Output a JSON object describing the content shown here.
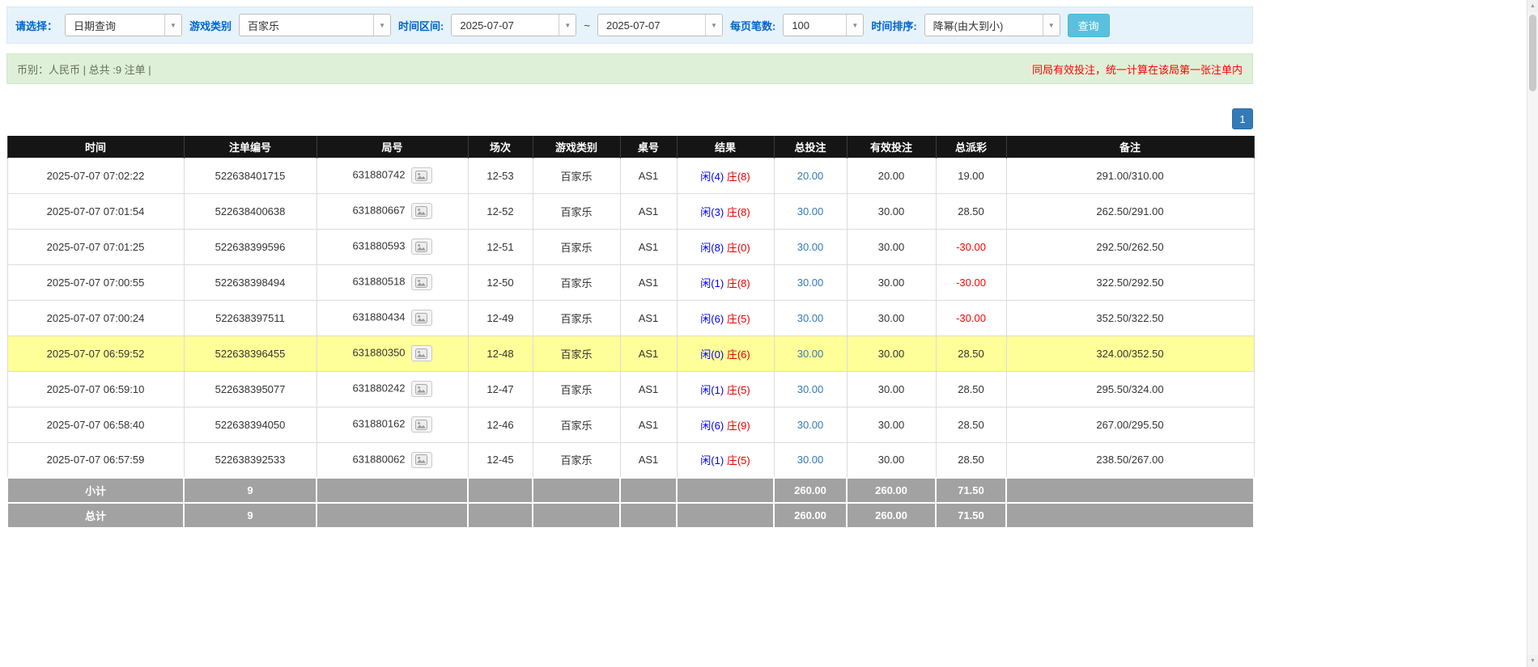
{
  "filter": {
    "select_label": "请选择：",
    "query_type": "日期查询",
    "game_label": "游戏类别",
    "game_value": "百家乐",
    "range_label": "时间区间:",
    "date_from": "2025-07-07",
    "range_sep": "~",
    "date_to": "2025-07-07",
    "page_size_label": "每页笔数:",
    "page_size_value": "100",
    "sort_label": "时间排序:",
    "sort_value": "降幂(由大到小)",
    "search_button": "查询"
  },
  "info_bar": {
    "summary": "币别：人民币 | 总共 :9 注单 |",
    "notice": "同局有效投注，统一计算在该局第一张注单内"
  },
  "pagination": {
    "current": "1"
  },
  "icons": {
    "dropdown_arrow": "▼",
    "scroll_up": "▲",
    "scroll_down": "▼",
    "round_media_icon": "video-thumbnail-icon"
  },
  "colors": {
    "accent_blue": "#337ab7",
    "search_button": "#5bc0de",
    "player_blue": "#0000ee",
    "banker_red": "#e60000",
    "negative_red": "#ff0000",
    "highlight_yellow": "#ffff99",
    "header_black": "#151515",
    "footer_gray": "#a2a2a2"
  },
  "table": {
    "headers": [
      "时间",
      "注单编号",
      "局号",
      "场次",
      "游戏类别",
      "桌号",
      "结果",
      "总投注",
      "有效投注",
      "总派彩",
      "备注"
    ],
    "rows": [
      {
        "time": "2025-07-07 07:02:22",
        "bet_no": "522638401715",
        "round_no": "631880742",
        "session": "12-53",
        "game": "百家乐",
        "table_no": "AS1",
        "result_player": "闲(4)",
        "result_banker": "庄(8)",
        "total_bet": "20.00",
        "valid_bet": "20.00",
        "payout": "19.00",
        "note": "291.00/310.00",
        "highlight": false
      },
      {
        "time": "2025-07-07 07:01:54",
        "bet_no": "522638400638",
        "round_no": "631880667",
        "session": "12-52",
        "game": "百家乐",
        "table_no": "AS1",
        "result_player": "闲(3)",
        "result_banker": "庄(8)",
        "total_bet": "30.00",
        "valid_bet": "30.00",
        "payout": "28.50",
        "note": "262.50/291.00",
        "highlight": false
      },
      {
        "time": "2025-07-07 07:01:25",
        "bet_no": "522638399596",
        "round_no": "631880593",
        "session": "12-51",
        "game": "百家乐",
        "table_no": "AS1",
        "result_player": "闲(8)",
        "result_banker": "庄(0)",
        "total_bet": "30.00",
        "valid_bet": "30.00",
        "payout": "-30.00",
        "note": "292.50/262.50",
        "highlight": false
      },
      {
        "time": "2025-07-07 07:00:55",
        "bet_no": "522638398494",
        "round_no": "631880518",
        "session": "12-50",
        "game": "百家乐",
        "table_no": "AS1",
        "result_player": "闲(1)",
        "result_banker": "庄(8)",
        "total_bet": "30.00",
        "valid_bet": "30.00",
        "payout": "-30.00",
        "note": "322.50/292.50",
        "highlight": false
      },
      {
        "time": "2025-07-07 07:00:24",
        "bet_no": "522638397511",
        "round_no": "631880434",
        "session": "12-49",
        "game": "百家乐",
        "table_no": "AS1",
        "result_player": "闲(6)",
        "result_banker": "庄(5)",
        "total_bet": "30.00",
        "valid_bet": "30.00",
        "payout": "-30.00",
        "note": "352.50/322.50",
        "highlight": false
      },
      {
        "time": "2025-07-07 06:59:52",
        "bet_no": "522638396455",
        "round_no": "631880350",
        "session": "12-48",
        "game": "百家乐",
        "table_no": "AS1",
        "result_player": "闲(0)",
        "result_banker": "庄(6)",
        "total_bet": "30.00",
        "valid_bet": "30.00",
        "payout": "28.50",
        "note": "324.00/352.50",
        "highlight": true
      },
      {
        "time": "2025-07-07 06:59:10",
        "bet_no": "522638395077",
        "round_no": "631880242",
        "session": "12-47",
        "game": "百家乐",
        "table_no": "AS1",
        "result_player": "闲(1)",
        "result_banker": "庄(5)",
        "total_bet": "30.00",
        "valid_bet": "30.00",
        "payout": "28.50",
        "note": "295.50/324.00",
        "highlight": false
      },
      {
        "time": "2025-07-07 06:58:40",
        "bet_no": "522638394050",
        "round_no": "631880162",
        "session": "12-46",
        "game": "百家乐",
        "table_no": "AS1",
        "result_player": "闲(6)",
        "result_banker": "庄(9)",
        "total_bet": "30.00",
        "valid_bet": "30.00",
        "payout": "28.50",
        "note": "267.00/295.50",
        "highlight": false
      },
      {
        "time": "2025-07-07 06:57:59",
        "bet_no": "522638392533",
        "round_no": "631880062",
        "session": "12-45",
        "game": "百家乐",
        "table_no": "AS1",
        "result_player": "闲(1)",
        "result_banker": "庄(5)",
        "total_bet": "30.00",
        "valid_bet": "30.00",
        "payout": "28.50",
        "note": "238.50/267.00",
        "highlight": false
      }
    ],
    "subtotal": {
      "label": "小计",
      "count": "9",
      "total_bet": "260.00",
      "valid_bet": "260.00",
      "payout": "71.50"
    },
    "grand_total": {
      "label": "总计",
      "count": "9",
      "total_bet": "260.00",
      "valid_bet": "260.00",
      "payout": "71.50"
    }
  }
}
